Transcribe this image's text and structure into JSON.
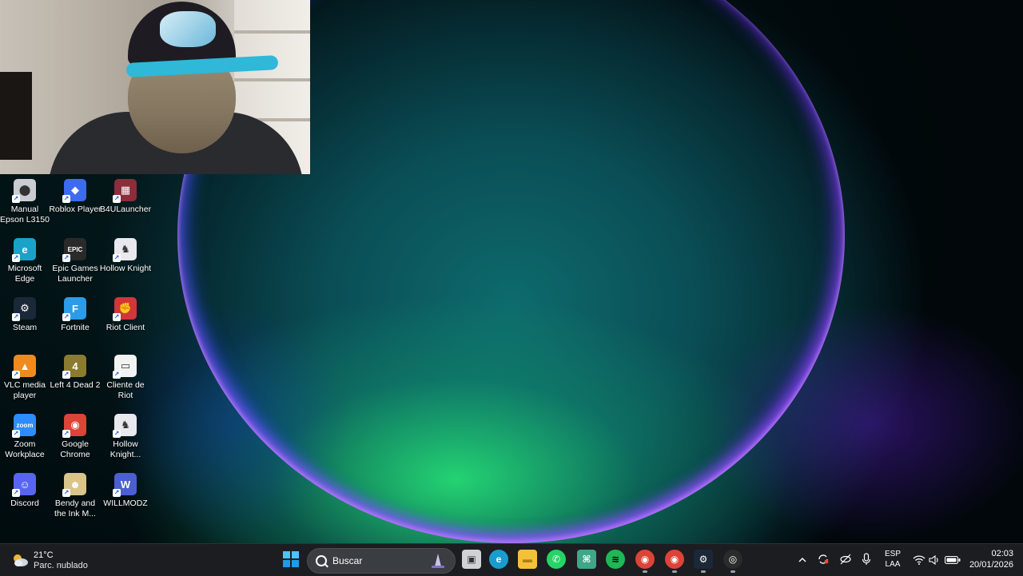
{
  "desktop": {
    "icons": [
      {
        "label": "Manual Epson L3150",
        "icon": "manual-epson-icon",
        "color": "#c9ccd1"
      },
      {
        "label": "Roblox Player",
        "icon": "roblox-icon",
        "color": "#3d6bf0"
      },
      {
        "label": "B4ULauncher",
        "icon": "b4u-icon",
        "color": "#8b2d3a"
      },
      {
        "label": "Microsoft Edge",
        "icon": "edge-icon",
        "color": "#1aa2c8"
      },
      {
        "label": "Epic Games Launcher",
        "icon": "epic-icon",
        "color": "#2a2a2a"
      },
      {
        "label": "Hollow Knight",
        "icon": "hollow-knight-icon",
        "color": "#e8e8ee"
      },
      {
        "label": "Steam",
        "icon": "steam-icon",
        "color": "#1b2838"
      },
      {
        "label": "Fortnite",
        "icon": "fortnite-icon",
        "color": "#2c9ce8"
      },
      {
        "label": "Riot Client",
        "icon": "riot-icon",
        "color": "#d13639"
      },
      {
        "label": "VLC media player",
        "icon": "vlc-icon",
        "color": "#f08a1c"
      },
      {
        "label": "Left 4 Dead 2",
        "icon": "l4d2-icon",
        "color": "#8a7b2e"
      },
      {
        "label": "Cliente de Riot",
        "icon": "file-icon",
        "color": "#f2f2f2"
      },
      {
        "label": "Zoom Workplace",
        "icon": "zoom-icon",
        "color": "#2d8cff"
      },
      {
        "label": "Google Chrome",
        "icon": "chrome-icon",
        "color": "#db4437"
      },
      {
        "label": "Hollow Knight...",
        "icon": "hollow-knight-icon",
        "color": "#e8e8ee"
      },
      {
        "label": "Discord",
        "icon": "discord-icon",
        "color": "#5865f2"
      },
      {
        "label": "Bendy and the Ink M...",
        "icon": "bendy-icon",
        "color": "#d9c48a"
      },
      {
        "label": "WILLMODZ",
        "icon": "willmodz-icon",
        "color": "#4b5fd1"
      }
    ]
  },
  "taskbar": {
    "weather": {
      "temp": "21°C",
      "desc": "Parc. nublado"
    },
    "search": {
      "placeholder": "Buscar"
    },
    "apps": [
      {
        "name": "start-button",
        "icon": "windows-icon"
      },
      {
        "name": "task-view",
        "icon": "task-view-icon"
      },
      {
        "name": "edge",
        "icon": "edge-icon"
      },
      {
        "name": "file-explorer",
        "icon": "folder-icon"
      },
      {
        "name": "whatsapp",
        "icon": "whatsapp-icon"
      },
      {
        "name": "app",
        "icon": "app-icon"
      },
      {
        "name": "spotify",
        "icon": "spotify-icon"
      },
      {
        "name": "chrome",
        "icon": "chrome-icon"
      },
      {
        "name": "chrome-2",
        "icon": "chrome-icon"
      },
      {
        "name": "steam",
        "icon": "steam-icon"
      },
      {
        "name": "obs",
        "icon": "obs-icon"
      }
    ],
    "tray": {
      "lang_top": "ESP",
      "lang_bottom": "LAA",
      "time": "02:03",
      "date": "20/01/2026"
    }
  }
}
